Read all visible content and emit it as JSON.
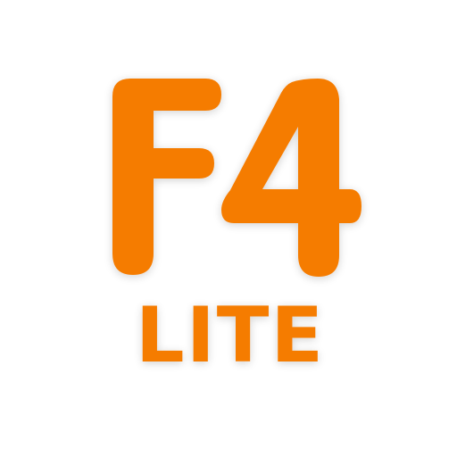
{
  "logo": {
    "primary_text": "F4",
    "secondary_text": "LITE",
    "brand_color": "#F57C00",
    "background_color": "#FFFFFF",
    "shadow_color": "#D8D8D8"
  }
}
